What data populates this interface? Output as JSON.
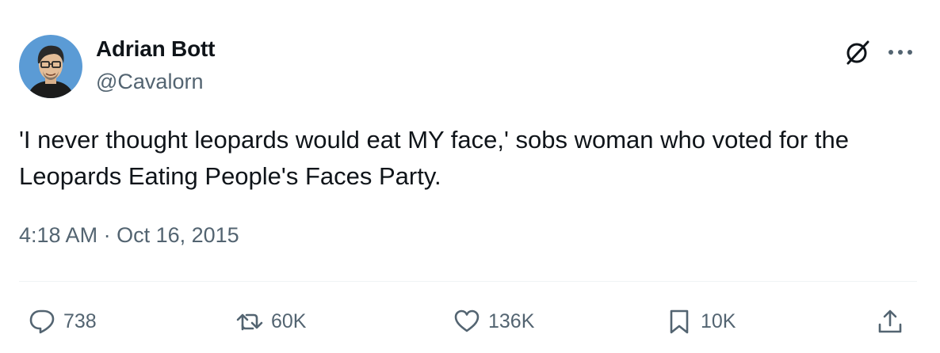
{
  "author": {
    "name": "Adrian Bott",
    "handle": "@Cavalorn"
  },
  "header_icons": [
    "grok-icon",
    "more-icon"
  ],
  "tweet": {
    "text": "'I never thought leopards would eat MY face,' sobs woman who voted for the Leopards Eating People's Faces Party.",
    "time": "4:18 AM",
    "separator": "·",
    "date": "Oct 16, 2015"
  },
  "actions": {
    "reply": {
      "icon": "reply-icon",
      "count": "738"
    },
    "retweet": {
      "icon": "retweet-icon",
      "count": "60K"
    },
    "like": {
      "icon": "heart-icon",
      "count": "136K"
    },
    "bookmark": {
      "icon": "bookmark-icon",
      "count": "10K"
    },
    "share": {
      "icon": "share-icon"
    }
  },
  "colors": {
    "text": "#0f1419",
    "secondary": "#536471",
    "divider": "#eff3f4",
    "avatar_bg": "#5b9bd5"
  }
}
